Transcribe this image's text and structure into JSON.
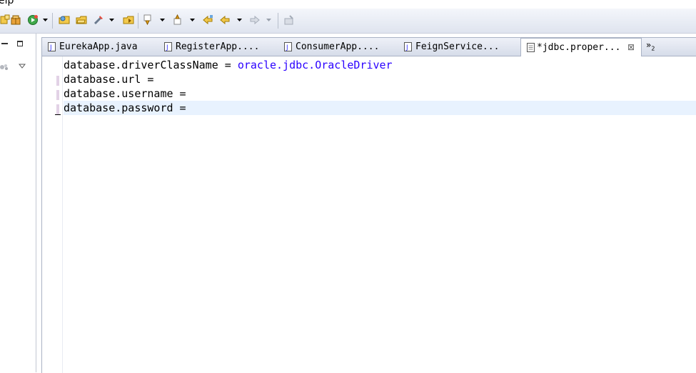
{
  "menu": {
    "visible_fragment": "elp"
  },
  "toolbar": {
    "buttons": [
      "new-server-icon",
      "build-icon",
      "run-icon",
      "run-dropdown-arrow",
      "open-type-icon",
      "open-task-icon",
      "search-icon",
      "search-dropdown-arrow",
      "open-perspective-icon",
      "next-annotation-icon",
      "next-annotation-dropdown-arrow",
      "previous-annotation-icon",
      "previous-annotation-dropdown-arrow",
      "last-edit-location-icon",
      "back-icon",
      "back-dropdown-arrow",
      "forward-icon",
      "forward-dropdown-arrow",
      "pin-editor-icon"
    ]
  },
  "editor": {
    "tabs": [
      {
        "label": "EurekaApp.java"
      },
      {
        "label": "RegisterApp...."
      },
      {
        "label": "ConsumerApp...."
      },
      {
        "label": "FeignService..."
      },
      {
        "label": "*jdbc.proper...",
        "active": true
      }
    ],
    "overflow": {
      "symbol": "»",
      "count": "2"
    },
    "lines": [
      {
        "key": "database.driverClassName",
        "sep": " = ",
        "value": "oracle.jdbc.OracleDriver"
      },
      {
        "key": "database.url",
        "sep": " =",
        "value": ""
      },
      {
        "key": "database.username",
        "sep": " =",
        "value": ""
      },
      {
        "key": "database.password",
        "sep": " =",
        "value": ""
      }
    ]
  },
  "colors": {
    "property_value": "#2a00ff",
    "current_line": "#e8f2fe",
    "change_marker": "#e2d2e6"
  }
}
